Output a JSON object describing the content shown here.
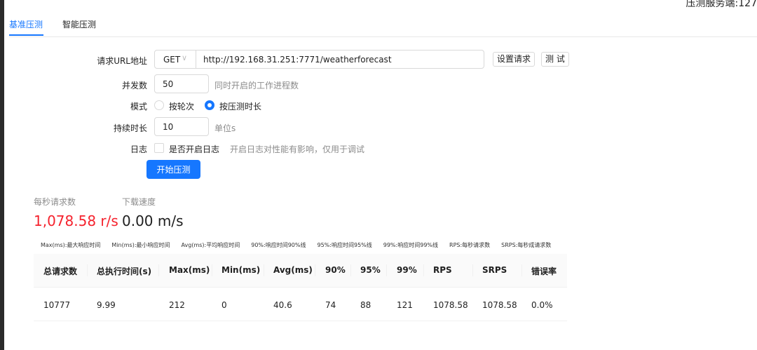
{
  "server_label": "压测服务端:127",
  "tabs": [
    {
      "label": "基准压测",
      "active": true
    },
    {
      "label": "智能压测",
      "active": false
    }
  ],
  "form": {
    "url_label": "请求URL地址",
    "method": "GET",
    "url": "http://192.168.31.251:7771/weatherforecast",
    "config_button": "设置请求",
    "test_button": "测 试",
    "concurrency_label": "并发数",
    "concurrency_value": "50",
    "concurrency_hint": "同时开启的工作进程数",
    "mode_label": "模式",
    "mode_options": [
      "按轮次",
      "按压测时长"
    ],
    "mode_selected": "按压测时长",
    "duration_label": "持续时长",
    "duration_value": "10",
    "duration_hint": "单位s",
    "log_label": "日志",
    "log_checkbox_label": "是否开启日志",
    "log_checked": false,
    "log_hint": "开启日志对性能有影响，仅用于调试",
    "start_button": "开始压测"
  },
  "stats": {
    "rps_title": "每秒请求数",
    "rps_value": "1,078.58 r/s",
    "download_title": "下载速度",
    "download_value": "0.00 m/s"
  },
  "legend": "Max(ms):最大响应时间　　Min(ms):最小响应时间　　Avg(ms):平均响应时间　　90%:响应时间90%线　　95%:响应时间95%线　　99%:响应时间99%线　　RPS:每秒请求数　　SRPS:每秒成请求数",
  "table": {
    "headers": [
      "总请求数",
      "总执行时间(s)",
      "Max(ms)",
      "Min(ms)",
      "Avg(ms)",
      "90%",
      "95%",
      "99%",
      "RPS",
      "SRPS",
      "错误率"
    ],
    "rows": [
      [
        "10777",
        "9.99",
        "212",
        "0",
        "40.6",
        "74",
        "88",
        "121",
        "1078.58",
        "1078.58",
        "0.0%"
      ]
    ]
  },
  "colors": {
    "primary": "#1677ff",
    "rps_value": "#f5222d"
  }
}
